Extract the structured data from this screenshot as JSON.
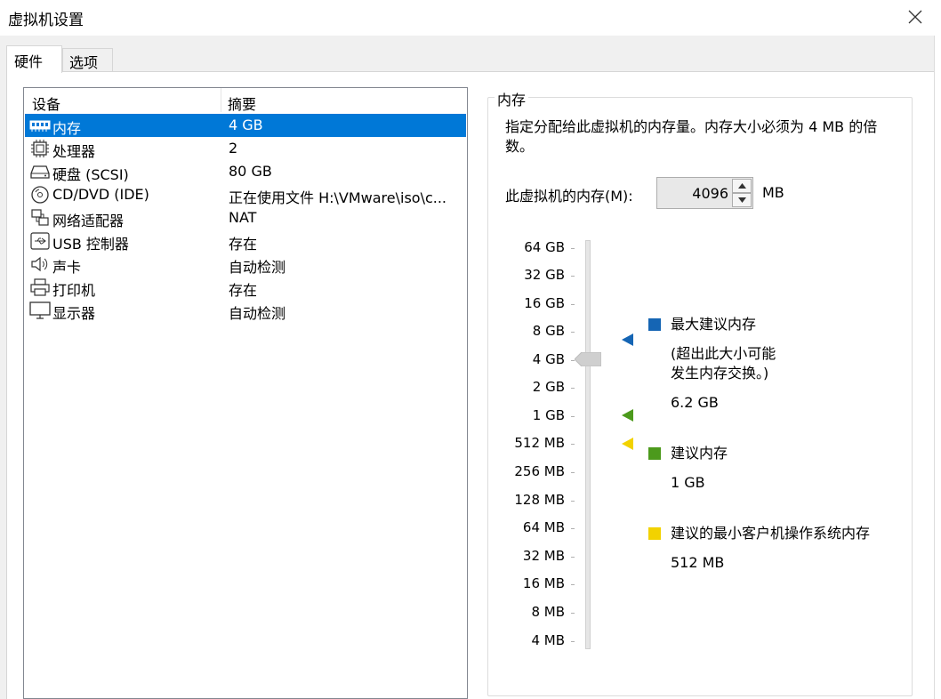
{
  "window": {
    "title": "虚拟机设置"
  },
  "tabs": [
    {
      "label": "硬件",
      "active": true
    },
    {
      "label": "选项",
      "active": false
    }
  ],
  "device_list": {
    "columns": [
      "设备",
      "摘要"
    ],
    "rows": [
      {
        "name": "内存",
        "summary": "4 GB",
        "icon": "memory-icon",
        "selected": true
      },
      {
        "name": "处理器",
        "summary": "2",
        "icon": "processor-icon",
        "selected": false
      },
      {
        "name": "硬盘 (SCSI)",
        "summary": "80 GB",
        "icon": "hard-disk-icon",
        "selected": false
      },
      {
        "name": "CD/DVD (IDE)",
        "summary": "正在使用文件 H:\\VMware\\iso\\c...",
        "icon": "cd-dvd-icon",
        "selected": false
      },
      {
        "name": "网络适配器",
        "summary": "NAT",
        "icon": "network-adapter-icon",
        "selected": false
      },
      {
        "name": "USB 控制器",
        "summary": "存在",
        "icon": "usb-icon",
        "selected": false
      },
      {
        "name": "声卡",
        "summary": "自动检测",
        "icon": "speaker-icon",
        "selected": false
      },
      {
        "name": "打印机",
        "summary": "存在",
        "icon": "printer-icon",
        "selected": false
      },
      {
        "name": "显示器",
        "summary": "自动检测",
        "icon": "monitor-icon",
        "selected": false
      }
    ]
  },
  "memory": {
    "group_label": "内存",
    "description": "指定分配给此虚拟机的内存量。内存大小必须为 4 MB 的倍数。",
    "field_label": "此虚拟机的内存(M):",
    "field_value": "4096",
    "unit": "MB",
    "scale": [
      "64 GB",
      "32 GB",
      "16 GB",
      "8 GB",
      "4 GB",
      "2 GB",
      "1 GB",
      "512 MB",
      "256 MB",
      "128 MB",
      "64 MB",
      "32 MB",
      "16 MB",
      "8 MB",
      "4 MB"
    ],
    "slider_value": "4 GB",
    "legend": {
      "max": {
        "title": "最大建议内存",
        "note_line1": "(超出此大小可能",
        "note_line2": "发生内存交换。)",
        "value": "6.2 GB",
        "color": "#1565b4"
      },
      "recommended": {
        "title": "建议内存",
        "value": "1 GB",
        "color": "#4c9a1c"
      },
      "min_guest": {
        "title": "建议的最小客户机操作系统内存",
        "value": "512 MB",
        "color": "#f2d200"
      }
    }
  },
  "colors": {
    "selection": "#0078d7"
  }
}
